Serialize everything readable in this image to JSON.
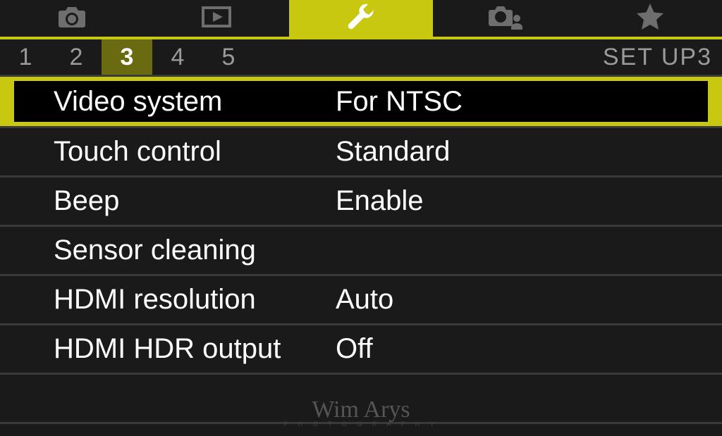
{
  "tabs": {
    "active_index": 2,
    "items": [
      {
        "icon": "camera-icon"
      },
      {
        "icon": "playback-icon"
      },
      {
        "icon": "wrench-icon"
      },
      {
        "icon": "camera-user-icon"
      },
      {
        "icon": "star-icon"
      }
    ]
  },
  "pages": {
    "active_index": 2,
    "numbers": [
      "1",
      "2",
      "3",
      "4",
      "5"
    ],
    "title": "SET  UP3"
  },
  "menu": {
    "selected_index": 0,
    "rows": [
      {
        "label": "Video system",
        "value": "For NTSC"
      },
      {
        "label": "Touch control",
        "value": "Standard"
      },
      {
        "label": "Beep",
        "value": "Enable"
      },
      {
        "label": "Sensor cleaning",
        "value": ""
      },
      {
        "label": "HDMI resolution",
        "value": "Auto"
      },
      {
        "label": "HDMI HDR output",
        "value": "Off"
      }
    ]
  },
  "watermark": {
    "name": "Wim Arys",
    "sub": "P H O T O G R A P H Y"
  },
  "colors": {
    "accent": "#c8c810",
    "accent_dark": "#6a6a10",
    "bg": "#1a1a1a",
    "divider": "#3a3a3a",
    "text_muted": "#9a9a9a"
  }
}
